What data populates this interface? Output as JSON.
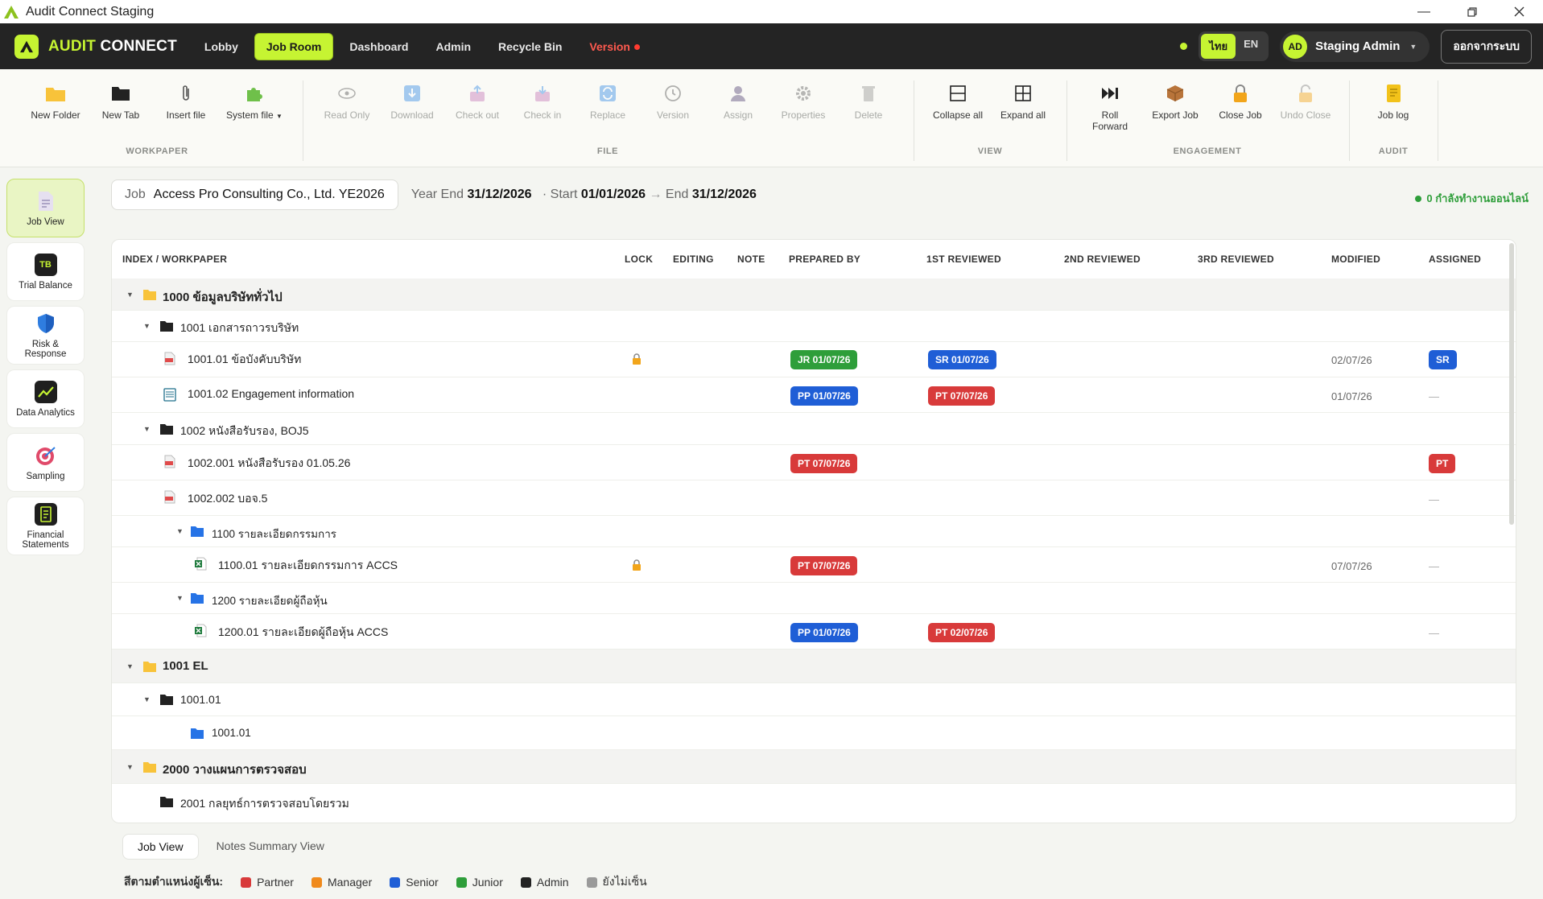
{
  "window": {
    "title": "Audit Connect Staging"
  },
  "brand": {
    "part1": "AUDIT",
    "part2": "CONNECT"
  },
  "nav": {
    "items": [
      {
        "label": "Lobby"
      },
      {
        "label": "Job Room"
      },
      {
        "label": "Dashboard"
      },
      {
        "label": "Admin"
      },
      {
        "label": "Recycle Bin"
      },
      {
        "label": "Version"
      }
    ],
    "lang_th": "ไทย",
    "lang_en": "EN",
    "user_initials": "AD",
    "user_name": "Staging Admin",
    "logout": "ออกจากระบบ"
  },
  "ribbon": {
    "buttons": {
      "new_folder": "New Folder",
      "new_tab": "New Tab",
      "insert_file": "Insert file",
      "system_file": "System file",
      "read_only": "Read Only",
      "download": "Download",
      "check_out": "Check out",
      "check_in": "Check in",
      "replace": "Replace",
      "version": "Version",
      "assign": "Assign",
      "properties": "Properties",
      "delete": "Delete",
      "collapse_all": "Collapse all",
      "expand_all": "Expand all",
      "roll_forward_1": "Roll",
      "roll_forward_2": "Forward",
      "export_job": "Export Job",
      "close_job": "Close Job",
      "undo_close": "Undo Close",
      "job_log": "Job log"
    },
    "groups": {
      "workpaper": "WORKPAPER",
      "file": "FILE",
      "view": "VIEW",
      "engagement": "ENGAGEMENT",
      "audit": "AUDIT"
    }
  },
  "sidebar": {
    "items": [
      {
        "label": "Job View"
      },
      {
        "label": "Trial Balance",
        "icon_text": "TB"
      },
      {
        "label1": "Risk &",
        "label2": "Response"
      },
      {
        "label": "Data Analytics"
      },
      {
        "label": "Sampling"
      },
      {
        "label1": "Financial",
        "label2": "Statements"
      }
    ]
  },
  "job": {
    "label": "Job",
    "name": "Access Pro Consulting Co., Ltd. YE2026",
    "year_end_label": "Year End",
    "year_end": "31/12/2026",
    "start_label": "· Start",
    "start": "01/01/2026",
    "arrow": "→",
    "end_label": "End",
    "end": "31/12/2026",
    "online": "0 กำลังทำงานออนไลน์"
  },
  "table": {
    "headers": {
      "index": "INDEX / WORKPAPER",
      "lock": "LOCK",
      "editing": "EDITING",
      "note": "NOTE",
      "prepared": "PREPARED BY",
      "r1": "1ST REVIEWED",
      "r2": "2ND REVIEWED",
      "r3": "3RD REVIEWED",
      "modified": "MODIFIED",
      "assigned": "ASSIGNED"
    },
    "rows": [
      {
        "label": "1000 ข้อมูลบริษัททั่วไป"
      },
      {
        "label": "1001 เอกสารถาวรบริษัท"
      },
      {
        "label": "1001.01 ข้อบังคับบริษัท",
        "prepared": "JR 01/07/26",
        "r1": "SR 01/07/26",
        "modified": "02/07/26",
        "assigned": "SR"
      },
      {
        "label": "1001.02 Engagement information",
        "prepared": "PP 01/07/26",
        "r1": "PT 07/07/26",
        "modified": "01/07/26",
        "assigned": "—"
      },
      {
        "label": "1002 หนังสือรับรอง, BOJ5"
      },
      {
        "label": "1002.001 หนังสือรับรอง 01.05.26",
        "prepared": "PT 07/07/26",
        "assigned": "PT"
      },
      {
        "label": "1002.002 บอจ.5",
        "assigned": "—"
      },
      {
        "label": "1100 รายละเอียดกรรมการ"
      },
      {
        "label": "1100.01 รายละเอียดกรรมการ ACCS",
        "prepared": "PT 07/07/26",
        "modified": "07/07/26",
        "assigned": "—"
      },
      {
        "label": "1200 รายละเอียดผู้ถือหุ้น"
      },
      {
        "label": "1200.01 รายละเอียดผู้ถือหุ้น ACCS",
        "prepared": "PP 01/07/26",
        "r1": "PT 02/07/26",
        "assigned": "—"
      },
      {
        "label": "1001 EL"
      },
      {
        "label": "1001.01"
      },
      {
        "label": "1001.01"
      },
      {
        "label": "2000 วางแผนการตรวจสอบ"
      },
      {
        "label": "2001 กลยุทธ์การตรวจสอบโดยรวม"
      }
    ]
  },
  "bottom": {
    "tab_job": "Job View",
    "tab_notes": "Notes Summary View",
    "legend_title": "สีตามตำแหน่งผู้เซ็น:",
    "legend": [
      {
        "label": "Partner",
        "color": "#d83a3a"
      },
      {
        "label": "Manager",
        "color": "#f08a1c"
      },
      {
        "label": "Senior",
        "color": "#1f5ed6"
      },
      {
        "label": "Junior",
        "color": "#2e9e3a"
      },
      {
        "label": "Admin",
        "color": "#222222"
      },
      {
        "label": "ยังไม่เซ็น",
        "color": "#9a9a9a"
      }
    ]
  },
  "colors": {
    "accent": "#c6f432",
    "nav_bg": "#242424"
  }
}
